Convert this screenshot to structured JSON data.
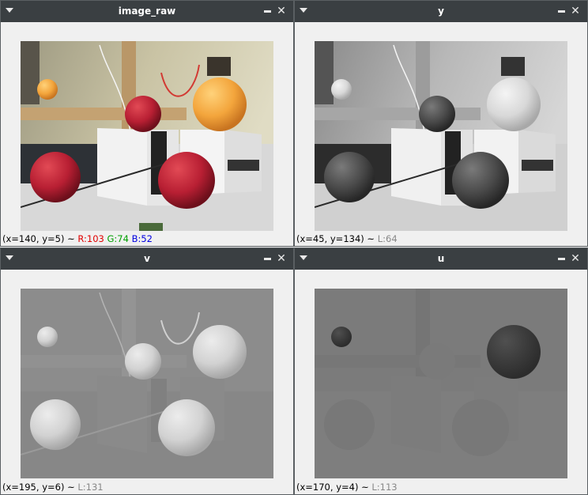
{
  "windows": [
    {
      "id": "image_raw",
      "title": "image_raw",
      "coords": "(x=140, y=5)",
      "sep": " ~ ",
      "channels": [
        {
          "label": "R:103",
          "color": "#e00000"
        },
        {
          "label": "G:74",
          "color": "#00a000"
        },
        {
          "label": "B:52",
          "color": "#0000e0"
        }
      ]
    },
    {
      "id": "y",
      "title": "y",
      "coords": "(x=45, y=134)",
      "sep": " ~ ",
      "channels": [
        {
          "label": "L:64",
          "color": "#888888"
        }
      ]
    },
    {
      "id": "v",
      "title": "v",
      "coords": "(x=195, y=6)",
      "sep": " ~ ",
      "channels": [
        {
          "label": "L:131",
          "color": "#888888"
        }
      ]
    },
    {
      "id": "u",
      "title": "u",
      "coords": "(x=170, y=4)",
      "sep": " ~ ",
      "channels": [
        {
          "label": "L:113",
          "color": "#888888"
        }
      ]
    }
  ],
  "icons": {
    "menu": "chevron-down-icon",
    "minimize": "minimize-icon",
    "close": "close-icon"
  },
  "close_glyph": "✕"
}
